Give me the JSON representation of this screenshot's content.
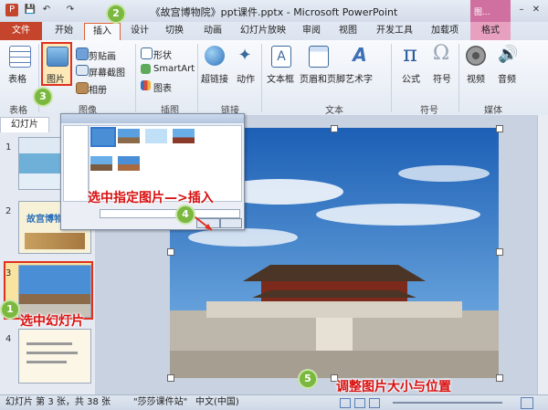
{
  "window": {
    "title": "《故宫博物院》ppt课件.pptx - Microsoft PowerPoint",
    "context_tab_label": "图..."
  },
  "tabs": {
    "file": "文件",
    "items": [
      "开始",
      "插入",
      "设计",
      "切换",
      "动画",
      "幻灯片放映",
      "审阅",
      "视图",
      "开发工具",
      "加载项",
      "格式"
    ]
  },
  "ribbon": {
    "table": {
      "label": "表格",
      "group": "表格"
    },
    "picture": {
      "label": "图片"
    },
    "clipart": {
      "label": "剪贴画"
    },
    "screenshot": {
      "label": "屏幕截图"
    },
    "album": {
      "label": "相册"
    },
    "images_group": "图像",
    "shapes": {
      "label": "形状"
    },
    "smartart": {
      "label": "SmartArt"
    },
    "chart": {
      "label": "图表"
    },
    "illustrations_group": "插图",
    "hyperlink": {
      "label": "超链接"
    },
    "action": {
      "label": "动作"
    },
    "links_group": "链接",
    "textbox": {
      "label": "文本框"
    },
    "header_footer": {
      "label": "页眉和页脚"
    },
    "wordart": {
      "label": "艺术字"
    },
    "text_group": "文本",
    "equation": {
      "label": "公式"
    },
    "symbol": {
      "label": "符号"
    },
    "symbols_group": "符号",
    "video": {
      "label": "视频"
    },
    "audio": {
      "label": "音频"
    },
    "media_group": "媒体"
  },
  "slides_panel": {
    "tab": "幻灯片",
    "numbers": [
      "1",
      "2",
      "3",
      "4"
    ],
    "slide2_title": "故宫博物院"
  },
  "annotations": [
    {
      "num": "1",
      "text": "选中幻灯片"
    },
    {
      "num": "2",
      "text": ""
    },
    {
      "num": "3",
      "text": ""
    },
    {
      "num": "4",
      "text": "选中指定图片—>插入"
    },
    {
      "num": "5",
      "text": "调整图片大小与位置"
    }
  ],
  "status": {
    "slide_info": "幻灯片 第 3 张，共 38 张",
    "theme": "\"莎莎课件站\"",
    "language": "中文(中国)"
  },
  "colors": {
    "accent_red": "#e03020",
    "file_tab": "#c5442c",
    "badge_green": "#7ab840"
  }
}
